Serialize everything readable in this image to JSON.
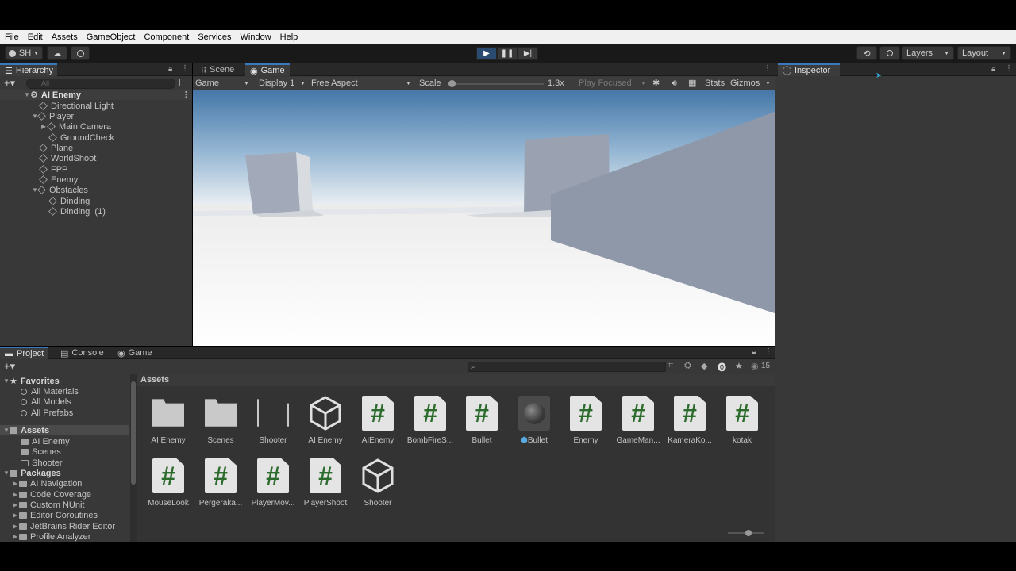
{
  "menu": [
    "File",
    "Edit",
    "Assets",
    "GameObject",
    "Component",
    "Services",
    "Window",
    "Help"
  ],
  "toolbar": {
    "account": "SH",
    "layers": "Layers",
    "layout": "Layout"
  },
  "hierarchy": {
    "tab": "Hierarchy",
    "search_placeholder": "All",
    "scene": "AI Enemy",
    "items": [
      {
        "label": "Directional Light"
      },
      {
        "label": "Player"
      },
      {
        "label": "Main Camera"
      },
      {
        "label": "GroundCheck"
      },
      {
        "label": "Plane"
      },
      {
        "label": "WorldShoot"
      },
      {
        "label": "FPP"
      },
      {
        "label": "Enemy"
      },
      {
        "label": "Obstacles"
      },
      {
        "label": "Dinding"
      },
      {
        "label": "Dinding  (1)"
      }
    ]
  },
  "gameview": {
    "tabs": [
      "Scene",
      "Game"
    ],
    "mode": "Game",
    "display": "Display 1",
    "aspect": "Free Aspect",
    "scale_label": "Scale",
    "scale_value": "1.3x",
    "play_focused": "Play Focused",
    "stats": "Stats",
    "gizmos": "Gizmos"
  },
  "inspector": {
    "tab": "Inspector"
  },
  "project": {
    "tabs": [
      "Project",
      "Console",
      "Game"
    ],
    "count": "15",
    "tree": {
      "favorites": "Favorites",
      "fav_items": [
        "All Materials",
        "All Models",
        "All Prefabs"
      ],
      "assets": "Assets",
      "asset_items": [
        "AI Enemy",
        "Scenes",
        "Shooter"
      ],
      "packages": "Packages",
      "package_items": [
        "AI Navigation",
        "Code Coverage",
        "Custom NUnit",
        "Editor Coroutines",
        "JetBrains Rider Editor",
        "Profile Analyzer"
      ]
    },
    "breadcrumb": "Assets",
    "assets": [
      {
        "name": "AI Enemy",
        "kind": "folder"
      },
      {
        "name": "Scenes",
        "kind": "folder"
      },
      {
        "name": "Shooter",
        "kind": "folder-empty"
      },
      {
        "name": "AI Enemy",
        "kind": "scene"
      },
      {
        "name": "AIEnemy",
        "kind": "script"
      },
      {
        "name": "BombFireS...",
        "kind": "script"
      },
      {
        "name": "Bullet",
        "kind": "script"
      },
      {
        "name": "Bullet",
        "kind": "prefab"
      },
      {
        "name": "Enemy",
        "kind": "script"
      },
      {
        "name": "GameMan...",
        "kind": "script"
      },
      {
        "name": "KameraKo...",
        "kind": "script"
      },
      {
        "name": "kotak",
        "kind": "script"
      },
      {
        "name": "MouseLook",
        "kind": "script"
      },
      {
        "name": "Pergeraka...",
        "kind": "script"
      },
      {
        "name": "PlayerMov...",
        "kind": "script"
      },
      {
        "name": "PlayerShoot",
        "kind": "script"
      },
      {
        "name": "Shooter",
        "kind": "scene"
      }
    ]
  }
}
